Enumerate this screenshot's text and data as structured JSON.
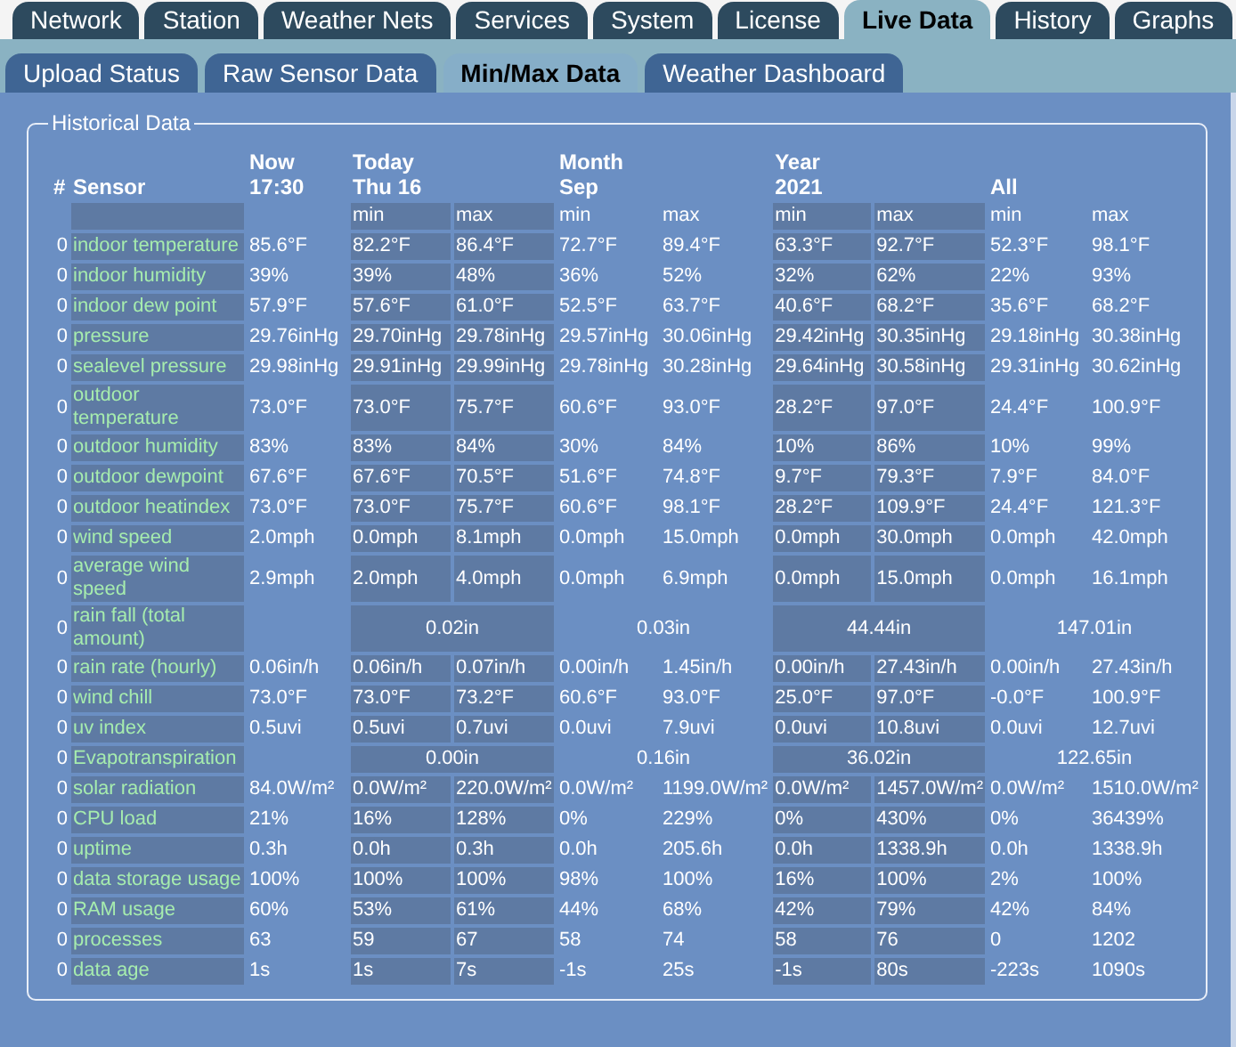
{
  "tabs": [
    {
      "label": "Network",
      "selected": false
    },
    {
      "label": "Station",
      "selected": false
    },
    {
      "label": "Weather Nets",
      "selected": false
    },
    {
      "label": "Services",
      "selected": false
    },
    {
      "label": "System",
      "selected": false
    },
    {
      "label": "License",
      "selected": false
    },
    {
      "label": "Live Data",
      "selected": true
    },
    {
      "label": "History",
      "selected": false
    },
    {
      "label": "Graphs",
      "selected": false
    }
  ],
  "subtabs": [
    {
      "label": "Upload Status",
      "selected": false
    },
    {
      "label": "Raw Sensor Data",
      "selected": false
    },
    {
      "label": "Min/Max Data",
      "selected": true
    },
    {
      "label": "Weather Dashboard",
      "selected": false
    }
  ],
  "panel": {
    "title": "Historical Data",
    "columns": {
      "hash": "#",
      "sensor": "Sensor",
      "groups": [
        {
          "title": "Now",
          "subtitle": "17:30",
          "kind": "single"
        },
        {
          "title": "Today",
          "subtitle": "Thu 16",
          "kind": "range",
          "min": "min",
          "max": "max"
        },
        {
          "title": "Month",
          "subtitle": "Sep",
          "kind": "range",
          "min": "min",
          "max": "max"
        },
        {
          "title": "Year",
          "subtitle": "2021",
          "kind": "range",
          "min": "min",
          "max": "max"
        },
        {
          "title": "All",
          "kind": "range",
          "min": "min",
          "max": "max"
        }
      ]
    },
    "rows": [
      {
        "id": "0",
        "sensor": "indoor temperature",
        "kind": "minmax",
        "now": "85.6°F",
        "values": [
          "82.2°F",
          "86.4°F",
          "72.7°F",
          "89.4°F",
          "63.3°F",
          "92.7°F",
          "52.3°F",
          "98.1°F"
        ]
      },
      {
        "id": "0",
        "sensor": "indoor humidity",
        "kind": "minmax",
        "now": "39%",
        "values": [
          "39%",
          "48%",
          "36%",
          "52%",
          "32%",
          "62%",
          "22%",
          "93%"
        ]
      },
      {
        "id": "0",
        "sensor": "indoor dew point",
        "kind": "minmax",
        "now": "57.9°F",
        "values": [
          "57.6°F",
          "61.0°F",
          "52.5°F",
          "63.7°F",
          "40.6°F",
          "68.2°F",
          "35.6°F",
          "68.2°F"
        ]
      },
      {
        "id": "0",
        "sensor": "pressure",
        "kind": "minmax",
        "now": "29.76inHg",
        "values": [
          "29.70inHg",
          "29.78inHg",
          "29.57inHg",
          "30.06inHg",
          "29.42inHg",
          "30.35inHg",
          "29.18inHg",
          "30.38inHg"
        ]
      },
      {
        "id": "0",
        "sensor": "sealevel pressure",
        "kind": "minmax",
        "now": "29.98inHg",
        "values": [
          "29.91inHg",
          "29.99inHg",
          "29.78inHg",
          "30.28inHg",
          "29.64inHg",
          "30.58inHg",
          "29.31inHg",
          "30.62inHg"
        ]
      },
      {
        "id": "0",
        "sensor": "outdoor temperature",
        "kind": "minmax",
        "now": "73.0°F",
        "values": [
          "73.0°F",
          "75.7°F",
          "60.6°F",
          "93.0°F",
          "28.2°F",
          "97.0°F",
          "24.4°F",
          "100.9°F"
        ]
      },
      {
        "id": "0",
        "sensor": "outdoor humidity",
        "kind": "minmax",
        "now": "83%",
        "values": [
          "83%",
          "84%",
          "30%",
          "84%",
          "10%",
          "86%",
          "10%",
          "99%"
        ]
      },
      {
        "id": "0",
        "sensor": "outdoor dewpoint",
        "kind": "minmax",
        "now": "67.6°F",
        "values": [
          "67.6°F",
          "70.5°F",
          "51.6°F",
          "74.8°F",
          "9.7°F",
          "79.3°F",
          "7.9°F",
          "84.0°F"
        ]
      },
      {
        "id": "0",
        "sensor": "outdoor heatindex",
        "kind": "minmax",
        "now": "73.0°F",
        "values": [
          "73.0°F",
          "75.7°F",
          "60.6°F",
          "98.1°F",
          "28.2°F",
          "109.9°F",
          "24.4°F",
          "121.3°F"
        ]
      },
      {
        "id": "0",
        "sensor": "wind speed",
        "kind": "minmax",
        "now": "2.0mph",
        "values": [
          "0.0mph",
          "8.1mph",
          "0.0mph",
          "15.0mph",
          "0.0mph",
          "30.0mph",
          "0.0mph",
          "42.0mph"
        ]
      },
      {
        "id": "0",
        "sensor": "average wind speed",
        "kind": "minmax",
        "now": "2.9mph",
        "values": [
          "2.0mph",
          "4.0mph",
          "0.0mph",
          "6.9mph",
          "0.0mph",
          "15.0mph",
          "0.0mph",
          "16.1mph"
        ]
      },
      {
        "id": "0",
        "sensor": "rain fall (total amount)",
        "kind": "total",
        "values": [
          "0.02in",
          "0.03in",
          "44.44in",
          "147.01in"
        ]
      },
      {
        "id": "0",
        "sensor": "rain rate (hourly)",
        "kind": "minmax",
        "now": "0.06in/h",
        "values": [
          "0.06in/h",
          "0.07in/h",
          "0.00in/h",
          "1.45in/h",
          "0.00in/h",
          "27.43in/h",
          "0.00in/h",
          "27.43in/h"
        ]
      },
      {
        "id": "0",
        "sensor": "wind chill",
        "kind": "minmax",
        "now": "73.0°F",
        "values": [
          "73.0°F",
          "73.2°F",
          "60.6°F",
          "93.0°F",
          "25.0°F",
          "97.0°F",
          "-0.0°F",
          "100.9°F"
        ]
      },
      {
        "id": "0",
        "sensor": "uv index",
        "kind": "minmax",
        "now": "0.5uvi",
        "values": [
          "0.5uvi",
          "0.7uvi",
          "0.0uvi",
          "7.9uvi",
          "0.0uvi",
          "10.8uvi",
          "0.0uvi",
          "12.7uvi"
        ]
      },
      {
        "id": "0",
        "sensor": "Evapotranspiration",
        "kind": "total",
        "values": [
          "0.00in",
          "0.16in",
          "36.02in",
          "122.65in"
        ]
      },
      {
        "id": "0",
        "sensor": "solar radiation",
        "kind": "minmax",
        "now": "84.0W/m²",
        "values": [
          "0.0W/m²",
          "220.0W/m²",
          "0.0W/m²",
          "1199.0W/m²",
          "0.0W/m²",
          "1457.0W/m²",
          "0.0W/m²",
          "1510.0W/m²"
        ]
      },
      {
        "id": "0",
        "sensor": "CPU load",
        "kind": "minmax",
        "now": "21%",
        "values": [
          "16%",
          "128%",
          "0%",
          "229%",
          "0%",
          "430%",
          "0%",
          "36439%"
        ]
      },
      {
        "id": "0",
        "sensor": "uptime",
        "kind": "minmax",
        "now": "0.3h",
        "values": [
          "0.0h",
          "0.3h",
          "0.0h",
          "205.6h",
          "0.0h",
          "1338.9h",
          "0.0h",
          "1338.9h"
        ]
      },
      {
        "id": "0",
        "sensor": "data storage usage",
        "kind": "minmax",
        "now": "100%",
        "values": [
          "100%",
          "100%",
          "98%",
          "100%",
          "16%",
          "100%",
          "2%",
          "100%"
        ]
      },
      {
        "id": "0",
        "sensor": "RAM usage",
        "kind": "minmax",
        "now": "60%",
        "values": [
          "53%",
          "61%",
          "44%",
          "68%",
          "42%",
          "79%",
          "42%",
          "84%"
        ]
      },
      {
        "id": "0",
        "sensor": "processes",
        "kind": "minmax",
        "now": "63",
        "values": [
          "59",
          "67",
          "58",
          "74",
          "58",
          "76",
          "0",
          "1202"
        ]
      },
      {
        "id": "0",
        "sensor": "data age",
        "kind": "minmax",
        "now": "1s",
        "values": [
          "1s",
          "7s",
          "-1s",
          "25s",
          "-1s",
          "80s",
          "-223s",
          "1090s"
        ]
      }
    ]
  }
}
